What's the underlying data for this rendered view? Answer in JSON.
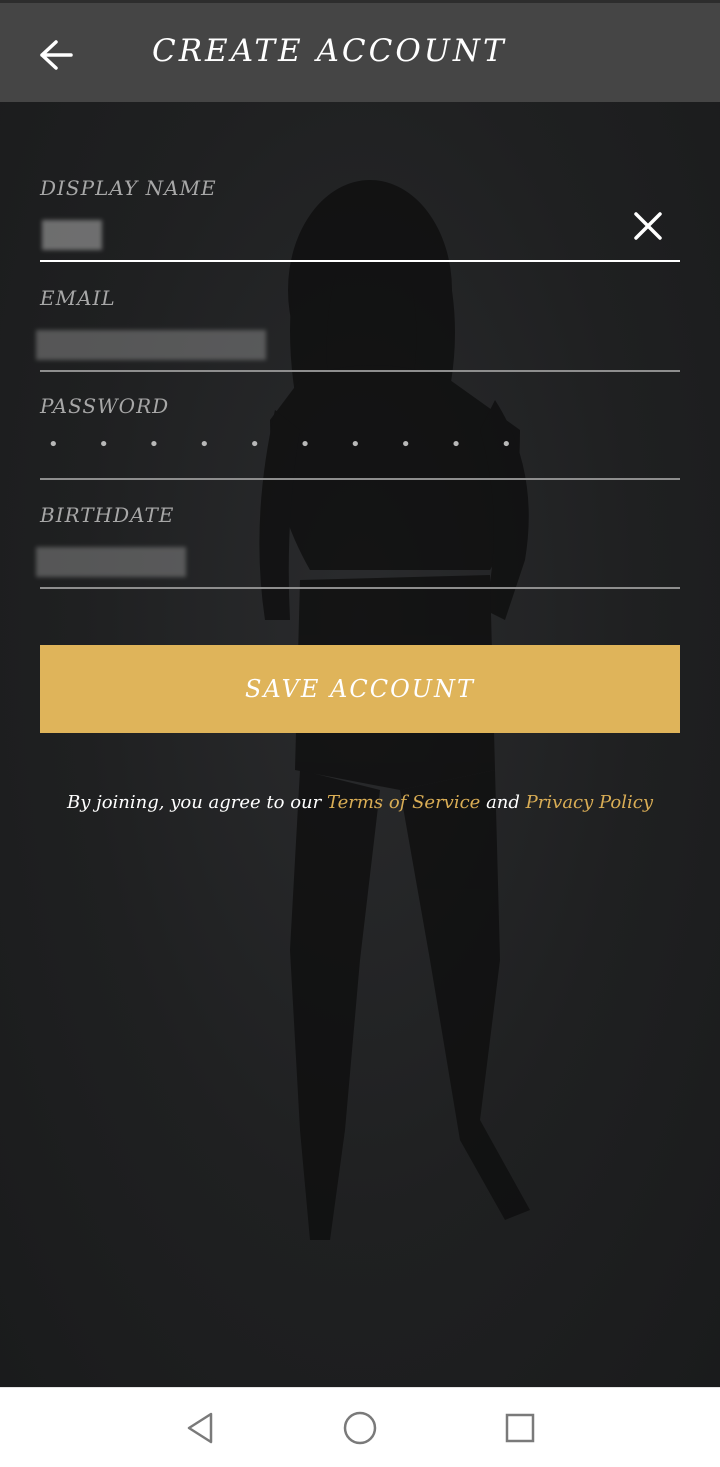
{
  "header": {
    "title": "CREATE ACCOUNT",
    "back_icon": "arrow-left-icon"
  },
  "form": {
    "display_name": {
      "label": "DISPLAY NAME",
      "value": "",
      "clear_icon": "close-icon"
    },
    "email": {
      "label": "EMAIL",
      "value": ""
    },
    "password": {
      "label": "PASSWORD",
      "masked_value": "• • • • • • • • • •"
    },
    "birthdate": {
      "label": "BIRTHDATE",
      "value": ""
    }
  },
  "save_button": {
    "label": "SAVE ACCOUNT"
  },
  "terms": {
    "prefix": "By joining, you agree to our",
    "terms_link": "Terms of Service",
    "conjunction": "and",
    "privacy_link": "Privacy Policy"
  },
  "colors": {
    "accent": "#dfb45a",
    "link": "#d9ad55",
    "header_bg": "#454545",
    "page_bg": "#1e1f20"
  },
  "system_nav": {
    "back_icon": "triangle-back-icon",
    "home_icon": "circle-home-icon",
    "recents_icon": "square-recents-icon"
  }
}
